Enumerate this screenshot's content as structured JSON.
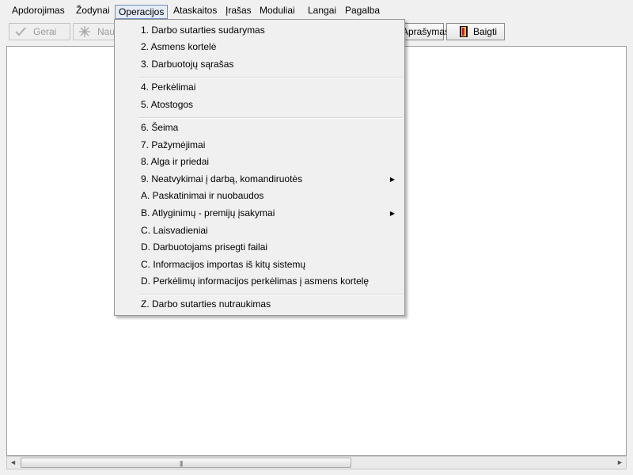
{
  "menubar": {
    "items": [
      {
        "label": "Apdorojimas"
      },
      {
        "label": "Žodynai"
      },
      {
        "label": "Operacijos"
      },
      {
        "label": "Ataskaitos"
      },
      {
        "label": "Įrašas"
      },
      {
        "label": "Moduliai"
      },
      {
        "label": "Langai"
      },
      {
        "label": "Pagalba"
      }
    ],
    "active": "Operacijos"
  },
  "toolbar": {
    "ok_label": "Gerai",
    "new_label": "Nau",
    "description_label": "Aprašymas",
    "finish_label": "Baigti"
  },
  "operations_menu": {
    "items": [
      {
        "label": "1. Darbo sutarties sudarymas"
      },
      {
        "label": "2. Asmens kortelė"
      },
      {
        "label": "3. Darbuotojų sąrašas"
      },
      {
        "label": "4. Perkėlimai"
      },
      {
        "label": "5. Atostogos"
      },
      {
        "label": "6. Šeima"
      },
      {
        "label": "7. Pažymėjimai"
      },
      {
        "label": "8. Alga ir priedai"
      },
      {
        "label": "9. Neatvykimai į darbą, komandiruotės",
        "submenu": true
      },
      {
        "label": "A. Paskatinimai ir nuobaudos"
      },
      {
        "label": "B. Atlyginimų - premijų įsakymai",
        "submenu": true
      },
      {
        "label": "C. Laisvadieniai"
      },
      {
        "label": "D. Darbuotojams prisegti failai"
      },
      {
        "label": "C. Informacijos importas iš kitų sistemų"
      },
      {
        "label": "D. Perkėlimų informacijos perkėlimas į asmens kortelę"
      },
      {
        "label": "Z. Darbo sutarties nutraukimas"
      }
    ]
  },
  "scrollbar": {
    "left_arrow": "◄",
    "right_arrow": "►",
    "grip": "|||"
  },
  "icons": {
    "ok": "checkmark-icon",
    "new": "new-star-icon",
    "finish": "exit-door-icon",
    "submenu": "submenu-arrow-icon"
  }
}
